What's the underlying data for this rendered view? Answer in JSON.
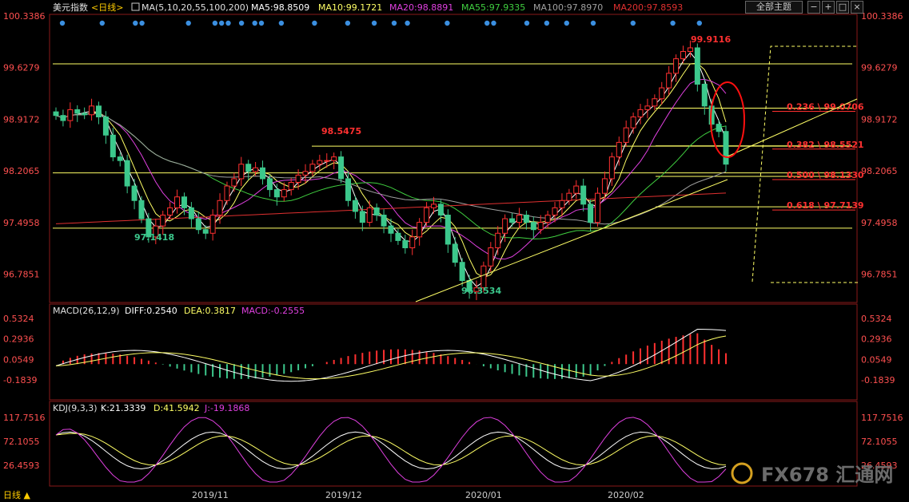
{
  "toolbar": {
    "title": "美元指数",
    "period": "<日线>",
    "ma_label": "MA(5,10,20,55,100,200)",
    "ma5": "MA5:98.8509",
    "ma10": "MA10:99.1721",
    "ma20": "MA20:98.8891",
    "ma55": "MA55:97.9335",
    "ma100": "MA100:97.8970",
    "ma200": "MA200:97.8593",
    "theme_button": "全部主题"
  },
  "colors": {
    "up": "#ff3030",
    "down": "#3cc88c",
    "ma5": "#ffffff",
    "ma10": "#ffff66",
    "ma20": "#e040e0",
    "ma55": "#40d040",
    "ma100": "#a0a0a0",
    "ma200": "#e03030",
    "fib": "#ffff66",
    "fibtext": "#ff3030"
  },
  "main": {
    "y_ticks": [
      "100.3386",
      "99.6279",
      "98.9172",
      "98.2065",
      "97.4958",
      "96.7851"
    ],
    "annotations": {
      "high": "99.9116",
      "swing_high": "98.5475",
      "low1": "97.1418",
      "low2": "96.3534"
    },
    "fib_labels": [
      "0.236 \\ 99.0706",
      "0.382 \\ 98.5521",
      "0.500 \\ 98.1330",
      "0.618 \\ 97.7139"
    ]
  },
  "macd": {
    "label": "MACD(26,12,9)",
    "diff": "DIFF:0.2540",
    "dea": "DEA:0.3817",
    "macd": "MACD:-0.2555",
    "y_ticks": [
      "0.5324",
      "0.2936",
      "0.0549",
      "-0.1839"
    ]
  },
  "kdj": {
    "label": "KDJ(9,3,3)",
    "k": "K:21.3339",
    "d": "D:41.5942",
    "j": "J:-19.1868",
    "y_ticks": [
      "117.7516",
      "72.1055",
      "26.4593"
    ]
  },
  "x_axis": {
    "ticks": [
      "2019/11",
      "2019/12",
      "2020/01",
      "2020/02"
    ],
    "corner": "日线 ▲"
  },
  "watermark": "FX678 汇通网",
  "chart_data": {
    "type": "candlestick",
    "title": "美元指数 <日线>",
    "ylim": [
      96.4,
      100.34
    ],
    "y_ticks": [
      100.3386,
      99.6279,
      98.9172,
      98.2065,
      97.4958,
      96.7851
    ],
    "x_ticks": [
      "2019/11",
      "2019/12",
      "2020/01",
      "2020/02"
    ],
    "closes": [
      98.97,
      98.9,
      99.05,
      99.0,
      98.98,
      99.1,
      98.95,
      98.7,
      98.4,
      98.35,
      98.0,
      97.8,
      97.55,
      97.3,
      97.45,
      97.6,
      97.7,
      97.85,
      97.7,
      97.55,
      97.4,
      97.35,
      97.6,
      97.8,
      98.0,
      98.1,
      98.3,
      98.2,
      98.25,
      98.1,
      97.95,
      97.85,
      97.95,
      98.05,
      98.15,
      98.2,
      98.3,
      98.35,
      98.35,
      98.4,
      98.1,
      97.8,
      97.65,
      97.5,
      97.7,
      97.6,
      97.45,
      97.35,
      97.25,
      97.15,
      97.3,
      97.5,
      97.7,
      97.75,
      97.6,
      97.2,
      96.95,
      96.7,
      96.55,
      96.6,
      96.9,
      97.15,
      97.35,
      97.55,
      97.5,
      97.6,
      97.5,
      97.4,
      97.5,
      97.6,
      97.7,
      97.8,
      97.9,
      98.0,
      97.75,
      97.5,
      97.9,
      98.1,
      98.4,
      98.6,
      98.8,
      98.95,
      99.05,
      99.1,
      99.2,
      99.35,
      99.55,
      99.75,
      99.85,
      99.9,
      99.4,
      99.1,
      98.85,
      98.75,
      98.3
    ],
    "fib_levels": [
      {
        "ratio": 0.236,
        "value": 99.0706
      },
      {
        "ratio": 0.382,
        "value": 98.5521
      },
      {
        "ratio": 0.5,
        "value": 98.133
      },
      {
        "ratio": 0.618,
        "value": 97.7139
      }
    ],
    "annotated_points": {
      "high": 99.9116,
      "swing_high": 98.5475,
      "low1": 97.1418,
      "low2": 96.3534
    },
    "ma_latest": {
      "MA5": 98.8509,
      "MA10": 99.1721,
      "MA20": 98.8891,
      "MA55": 97.9335,
      "MA100": 97.897,
      "MA200": 97.8593
    },
    "macd_latest": {
      "DIFF": 0.254,
      "DEA": 0.3817,
      "MACD": -0.2555
    },
    "kdj_latest": {
      "K": 21.3339,
      "D": 41.5942,
      "J": -19.1868
    },
    "grid": false
  }
}
